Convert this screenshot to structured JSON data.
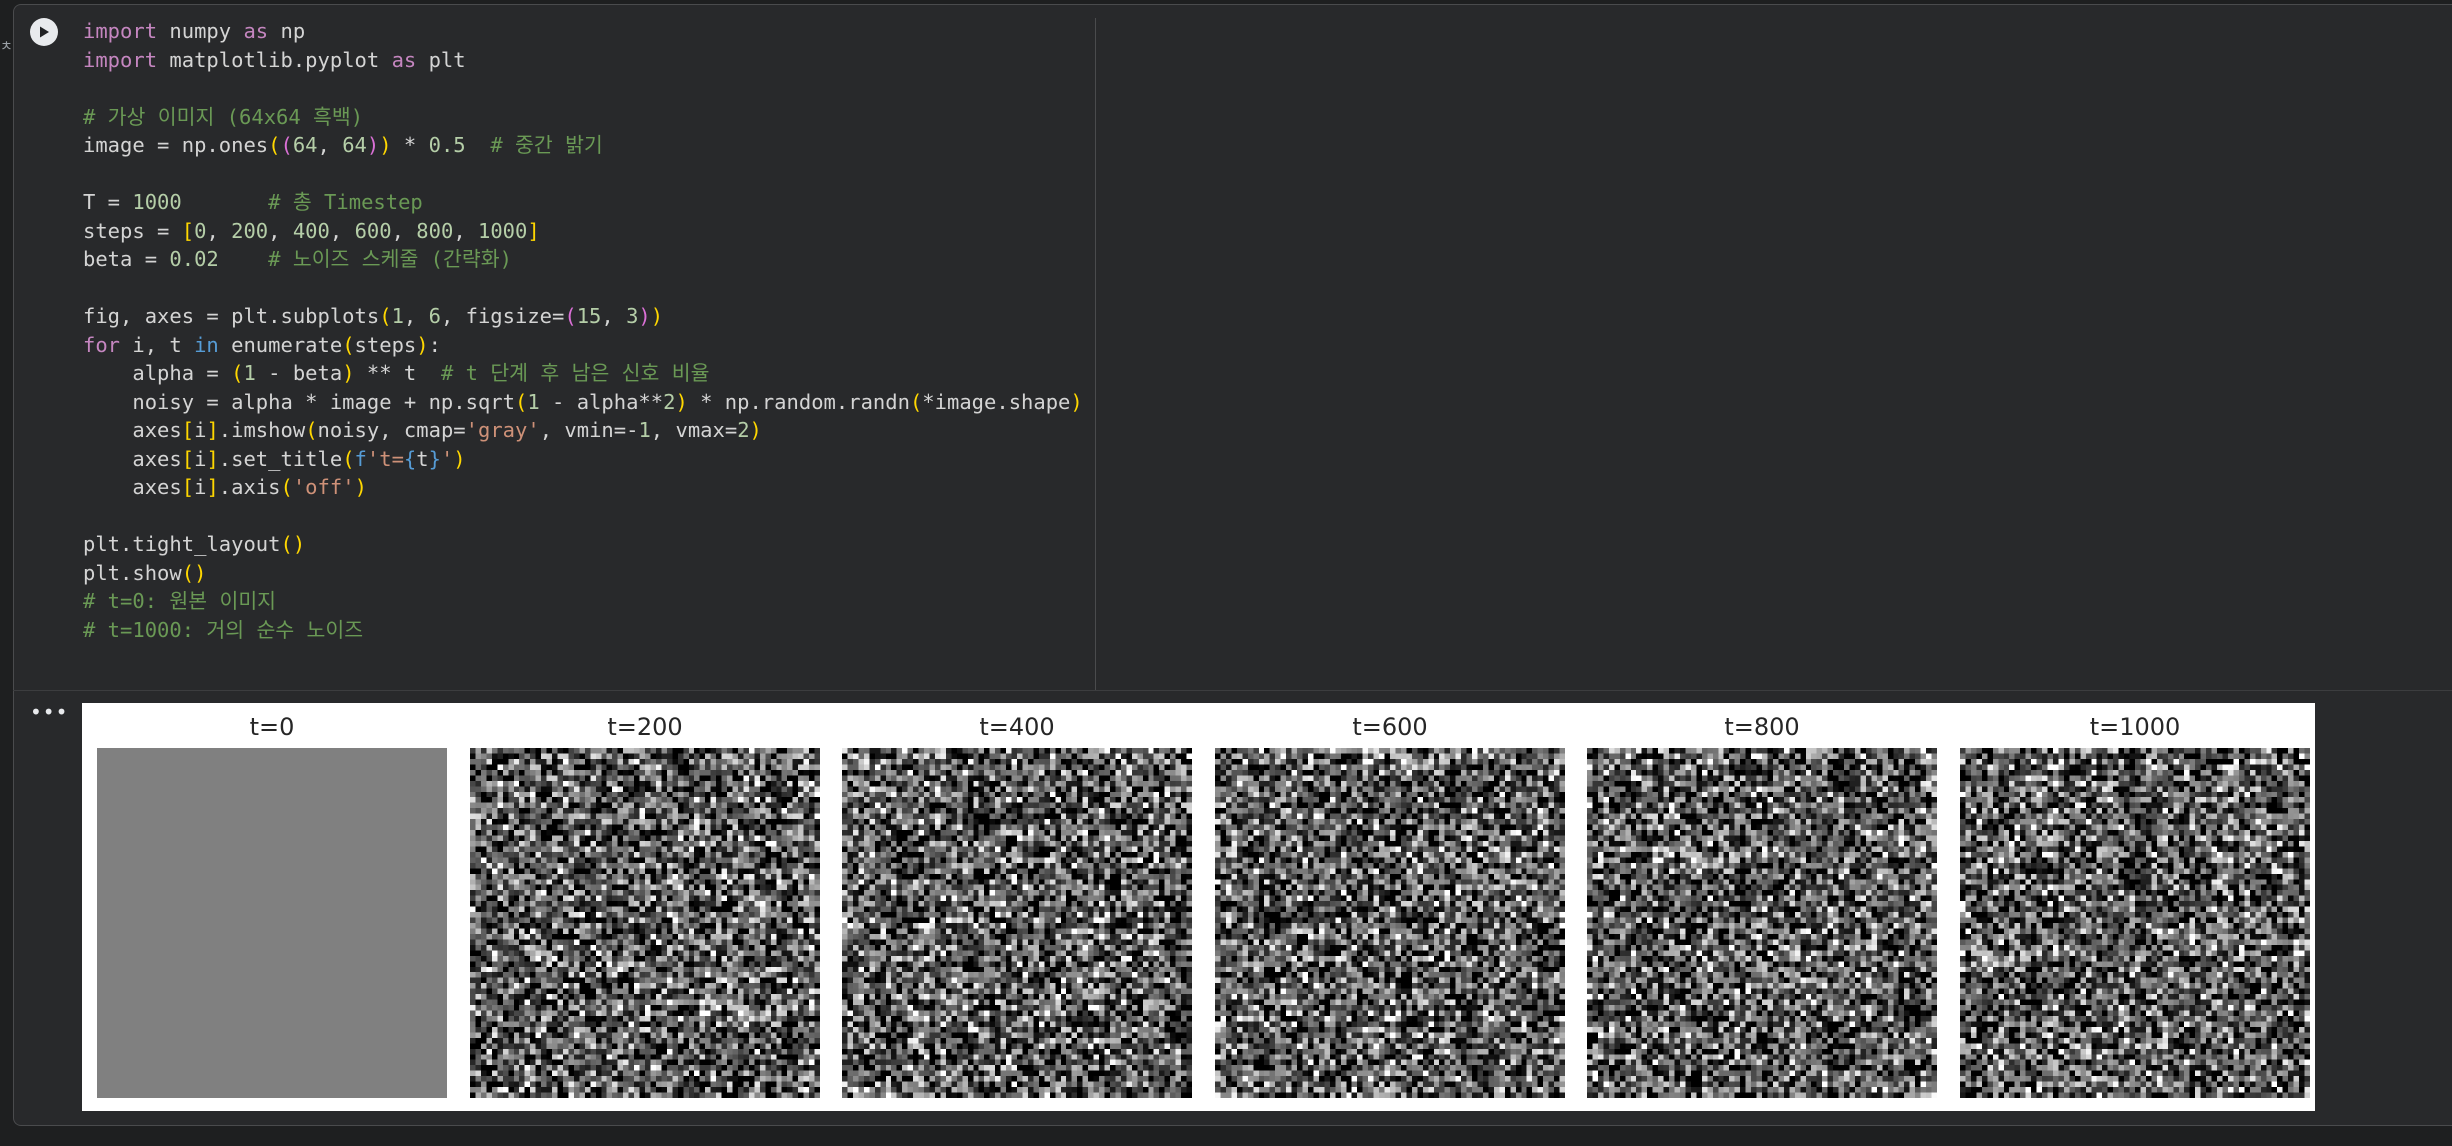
{
  "code_cell": {
    "run_icon": "play-icon",
    "lines": [
      [
        [
          "kw",
          "import"
        ],
        [
          "pl",
          " numpy "
        ],
        [
          "kw",
          "as"
        ],
        [
          "pl",
          " np"
        ]
      ],
      [
        [
          "kw",
          "import"
        ],
        [
          "pl",
          " matplotlib.pyplot "
        ],
        [
          "kw",
          "as"
        ],
        [
          "pl",
          " plt"
        ]
      ],
      [],
      [
        [
          "com",
          "# 가상 이미지 (64x64 흑백)"
        ]
      ],
      [
        [
          "pl",
          "image = np.ones"
        ],
        [
          "br1",
          "("
        ],
        [
          "br2",
          "("
        ],
        [
          "num",
          "64"
        ],
        [
          "pl",
          ", "
        ],
        [
          "num",
          "64"
        ],
        [
          "br2",
          ")"
        ],
        [
          "br1",
          ")"
        ],
        [
          "pl",
          " * "
        ],
        [
          "num",
          "0.5"
        ],
        [
          "pl",
          "  "
        ],
        [
          "com",
          "# 중간 밝기"
        ]
      ],
      [],
      [
        [
          "pl",
          "T = "
        ],
        [
          "num",
          "1000"
        ],
        [
          "pl",
          "       "
        ],
        [
          "com",
          "# 총 Timestep"
        ]
      ],
      [
        [
          "pl",
          "steps = "
        ],
        [
          "br1",
          "["
        ],
        [
          "num",
          "0"
        ],
        [
          "pl",
          ", "
        ],
        [
          "num",
          "200"
        ],
        [
          "pl",
          ", "
        ],
        [
          "num",
          "400"
        ],
        [
          "pl",
          ", "
        ],
        [
          "num",
          "600"
        ],
        [
          "pl",
          ", "
        ],
        [
          "num",
          "800"
        ],
        [
          "pl",
          ", "
        ],
        [
          "num",
          "1000"
        ],
        [
          "br1",
          "]"
        ]
      ],
      [
        [
          "pl",
          "beta = "
        ],
        [
          "num",
          "0.02"
        ],
        [
          "pl",
          "    "
        ],
        [
          "com",
          "# 노이즈 스케줄 (간략화)"
        ]
      ],
      [],
      [
        [
          "pl",
          "fig, axes = plt.subplots"
        ],
        [
          "br1",
          "("
        ],
        [
          "num",
          "1"
        ],
        [
          "pl",
          ", "
        ],
        [
          "num",
          "6"
        ],
        [
          "pl",
          ", figsize="
        ],
        [
          "br2",
          "("
        ],
        [
          "num",
          "15"
        ],
        [
          "pl",
          ", "
        ],
        [
          "num",
          "3"
        ],
        [
          "br2",
          ")"
        ],
        [
          "br1",
          ")"
        ]
      ],
      [
        [
          "kw",
          "for"
        ],
        [
          "pl",
          " i, t "
        ],
        [
          "kb",
          "in"
        ],
        [
          "pl",
          " enumerate"
        ],
        [
          "br1",
          "("
        ],
        [
          "pl",
          "steps"
        ],
        [
          "br1",
          ")"
        ],
        [
          "pl",
          ":"
        ]
      ],
      [
        [
          "pl",
          "    alpha = "
        ],
        [
          "br1",
          "("
        ],
        [
          "num",
          "1"
        ],
        [
          "pl",
          " - beta"
        ],
        [
          "br1",
          ")"
        ],
        [
          "pl",
          " ** t  "
        ],
        [
          "com",
          "# t 단계 후 남은 신호 비율"
        ]
      ],
      [
        [
          "pl",
          "    noisy = alpha * image + np.sqrt"
        ],
        [
          "br1",
          "("
        ],
        [
          "num",
          "1"
        ],
        [
          "pl",
          " - alpha**"
        ],
        [
          "num",
          "2"
        ],
        [
          "br1",
          ")"
        ],
        [
          "pl",
          " * np.random.randn"
        ],
        [
          "br1",
          "("
        ],
        [
          "pl",
          "*image.shape"
        ],
        [
          "br1",
          ")"
        ]
      ],
      [
        [
          "pl",
          "    axes"
        ],
        [
          "br1",
          "["
        ],
        [
          "pl",
          "i"
        ],
        [
          "br1",
          "]"
        ],
        [
          "pl",
          ".imshow"
        ],
        [
          "br1",
          "("
        ],
        [
          "pl",
          "noisy, cmap="
        ],
        [
          "str",
          "'gray'"
        ],
        [
          "pl",
          ", vmin=-"
        ],
        [
          "num",
          "1"
        ],
        [
          "pl",
          ", vmax="
        ],
        [
          "num",
          "2"
        ],
        [
          "br1",
          ")"
        ]
      ],
      [
        [
          "pl",
          "    axes"
        ],
        [
          "br1",
          "["
        ],
        [
          "pl",
          "i"
        ],
        [
          "br1",
          "]"
        ],
        [
          "pl",
          ".set_title"
        ],
        [
          "br1",
          "("
        ],
        [
          "kb",
          "f"
        ],
        [
          "str",
          "'t="
        ],
        [
          "kb",
          "{"
        ],
        [
          "pl",
          "t"
        ],
        [
          "kb",
          "}"
        ],
        [
          "str",
          "'"
        ],
        [
          "br1",
          ")"
        ]
      ],
      [
        [
          "pl",
          "    axes"
        ],
        [
          "br1",
          "["
        ],
        [
          "pl",
          "i"
        ],
        [
          "br1",
          "]"
        ],
        [
          "pl",
          ".axis"
        ],
        [
          "br1",
          "("
        ],
        [
          "str",
          "'off'"
        ],
        [
          "br1",
          ")"
        ]
      ],
      [],
      [
        [
          "pl",
          "plt.tight_layout"
        ],
        [
          "br1",
          "()"
        ]
      ],
      [
        [
          "pl",
          "plt.show"
        ],
        [
          "br1",
          "()"
        ]
      ],
      [
        [
          "com",
          "# t=0: 원본 이미지"
        ]
      ],
      [
        [
          "com",
          "# t=1000: 거의 순수 노이즈"
        ]
      ]
    ]
  },
  "output": {
    "menu_icon": "more-horizontal-icon",
    "more_glyph": "•••",
    "panels": [
      {
        "title": "t=0",
        "noise": false
      },
      {
        "title": "t=200",
        "noise": true
      },
      {
        "title": "t=400",
        "noise": true
      },
      {
        "title": "t=600",
        "noise": true
      },
      {
        "title": "t=800",
        "noise": true
      },
      {
        "title": "t=1000",
        "noise": true
      }
    ]
  },
  "colors": {
    "cell_bg": "#28292b",
    "page_bg": "#1e1f20",
    "uniform_gray": "#808080"
  }
}
